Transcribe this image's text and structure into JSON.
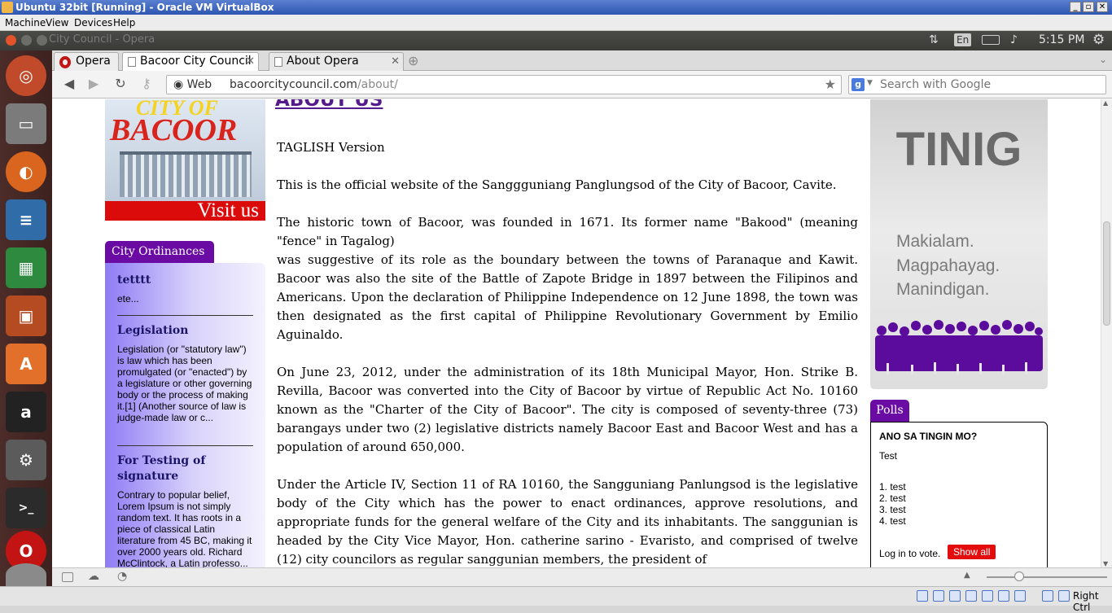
{
  "vbox": {
    "title": "Ubuntu 32bit [Running] - Oracle VM VirtualBox",
    "menu": [
      "Machine",
      "View",
      "Devices",
      "Help"
    ],
    "host_key": "Right Ctrl"
  },
  "ubuntu_panel": {
    "window_title": "City Council - Opera",
    "keyboard": "En",
    "time": "5:15 PM"
  },
  "launcher": [
    "ubuntu-dash",
    "files",
    "firefox",
    "libreoffice-writer",
    "libreoffice-calc",
    "libreoffice-impress",
    "ubuntu-software-center",
    "amazon",
    "system-settings",
    "terminal",
    "opera",
    "disc"
  ],
  "browser": {
    "menu_label": "Opera",
    "tabs": [
      {
        "label": "Bacoor City Council",
        "active": true
      },
      {
        "label": "About Opera",
        "active": false
      }
    ],
    "web_label": "Web",
    "url_host": "bacoorcitycouncil.com",
    "url_path": "/about/",
    "search_placeholder": "Search with Google"
  },
  "banner": {
    "top": "CITY OF",
    "name": "BACOOR",
    "cta": "Visit us"
  },
  "ordinances": {
    "title": "City Ordinances",
    "items": [
      {
        "title": "tetttt",
        "body": "ete..."
      },
      {
        "title": "Legislation",
        "body": "Legislation (or \"statutory law\") is law which has been promulgated (or \"enacted\") by a legislature or other governing body or the process of making it.[1] (Another source of law is judge-made law or c..."
      },
      {
        "title": "For Testing of signature",
        "body": "Contrary to popular belief, Lorem Ipsum is not simply random text. It has roots in a piece of classical Latin literature from 45 BC, making it over 2000 years old. Richard McClintock, a Latin professo..."
      }
    ]
  },
  "article": {
    "title": "ABOUT US",
    "paragraphs": [
      "TAGLISH Version",
      "This is the official website of the Sanggguniang Panglungsod of the City of Bacoor, Cavite.",
      "The historic town of Bacoor, was founded in 1671. Its former name \"Bakood\" (meaning \"fence\" in Tagalog)",
      "was suggestive of its role as the boundary between the towns of Paranaque and Kawit. Bacoor was also the site of the Battle of Zapote Bridge in 1897 between the Filipinos and Americans. Upon the declaration of Philippine Independence on 12 June 1898, the town was then designated as the first capital of Philippine Revolutionary Government by Emilio Aguinaldo.",
      "On June 23, 2012, under the administration of its 18th Municipal Mayor, Hon. Strike B. Revilla, Bacoor was converted into the City of Bacoor by virtue of Republic Act No. 10160 known as the \"Charter of the City of Bacoor\". The city is composed of seventy-three (73) barangays under two (2) legislative districts namely Bacoor East and Bacoor West and has a population of around 650,000.",
      "Under the Article IV, Section 11 of RA 10160, the Sangguniang Panlungsod is the legislative body of the City which has the power to enact ordinances, approve resolutions, and appropriate funds for the general welfare of the City and its inhabitants. The sanggunian is headed by the City Vice Mayor, Hon. catherine sarino - Evaristo, and comprised of twelve (12) city councilors as regular sanggunian members, the president of"
    ]
  },
  "tinig": {
    "title": "TINIG",
    "slogan": [
      "Makialam.",
      "Magpahayag.",
      "Manindigan."
    ]
  },
  "polls": {
    "title": "Polls",
    "question": "ANO SA TINGIN MO?",
    "answer": "Test",
    "options": [
      "1. test",
      "2. test",
      "3. test",
      "4. test"
    ],
    "login_text": "Log in to vote.",
    "show_all": "Show all"
  },
  "colors": {
    "accent_purple": "#6a0ca3",
    "link_purple": "#551a8b",
    "red": "#e30d0d"
  }
}
